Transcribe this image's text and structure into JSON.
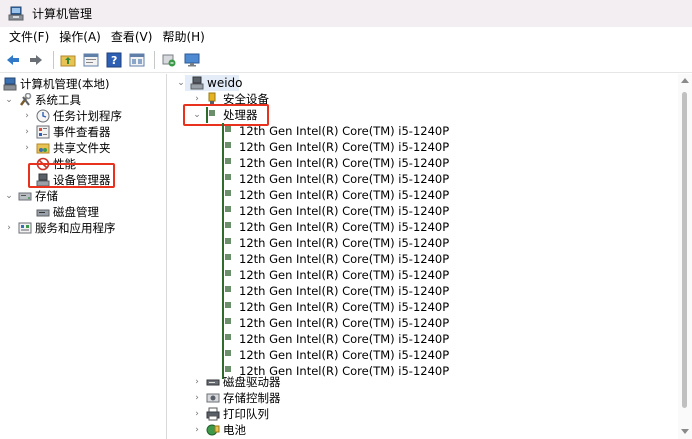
{
  "window": {
    "title": "计算机管理"
  },
  "menu": [
    {
      "label": "文件(F)"
    },
    {
      "label": "操作(A)"
    },
    {
      "label": "查看(V)"
    },
    {
      "label": "帮助(H)"
    }
  ],
  "toolbar": {
    "icons": [
      "back-arrow-icon",
      "forward-arrow-icon",
      "folder-up-icon",
      "properties-icon",
      "help-icon",
      "panel-icon",
      "refresh-icon",
      "monitor-icon"
    ]
  },
  "left_tree": {
    "root": "计算机管理(本地)",
    "system_tools": "系统工具",
    "task_scheduler": "任务计划程序",
    "event_viewer": "事件查看器",
    "shared_folders": "共享文件夹",
    "performance": "性能",
    "device_manager": "设备管理器",
    "storage": "存储",
    "disk_management": "磁盘管理",
    "services_apps": "服务和应用程序"
  },
  "right_tree": {
    "computer": "weido",
    "security_devices": "安全设备",
    "processors": "处理器",
    "cpu_items": [
      "12th Gen Intel(R) Core(TM) i5-1240P",
      "12th Gen Intel(R) Core(TM) i5-1240P",
      "12th Gen Intel(R) Core(TM) i5-1240P",
      "12th Gen Intel(R) Core(TM) i5-1240P",
      "12th Gen Intel(R) Core(TM) i5-1240P",
      "12th Gen Intel(R) Core(TM) i5-1240P",
      "12th Gen Intel(R) Core(TM) i5-1240P",
      "12th Gen Intel(R) Core(TM) i5-1240P",
      "12th Gen Intel(R) Core(TM) i5-1240P",
      "12th Gen Intel(R) Core(TM) i5-1240P",
      "12th Gen Intel(R) Core(TM) i5-1240P",
      "12th Gen Intel(R) Core(TM) i5-1240P",
      "12th Gen Intel(R) Core(TM) i5-1240P",
      "12th Gen Intel(R) Core(TM) i5-1240P",
      "12th Gen Intel(R) Core(TM) i5-1240P",
      "12th Gen Intel(R) Core(TM) i5-1240P"
    ],
    "disk_drives": "磁盘驱动器",
    "storage_controllers": "存储控制器",
    "print_queues": "打印队列",
    "battery": "电池"
  },
  "colors": {
    "highlight": "#e8321e",
    "selection": "#e4ecf7"
  }
}
